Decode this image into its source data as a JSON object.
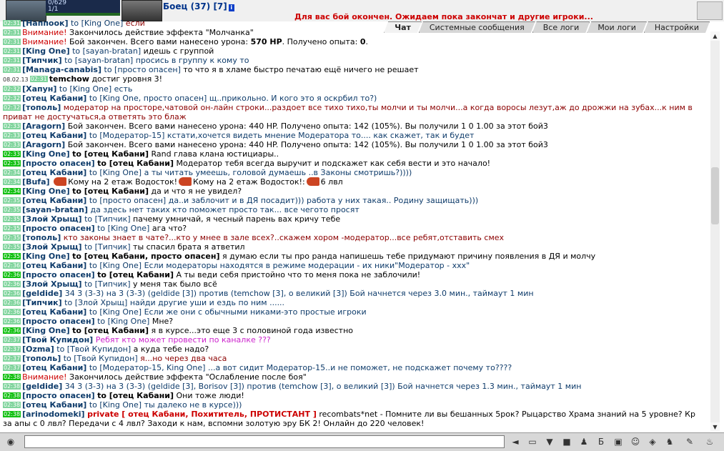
{
  "header": {
    "hp": "0/629",
    "mana": "1/1",
    "fighter": "Боец (37) [7]",
    "info_icon": "i",
    "fight_msg": "Для вас бой окончен. Ожидаем пока закончат и другие игроки..."
  },
  "tabs": [
    {
      "label": "Чат"
    },
    {
      "label": "Системные сообщения"
    },
    {
      "label": "Все логи"
    },
    {
      "label": "Мои логи"
    },
    {
      "label": "Настройки"
    }
  ],
  "messages": [
    {
      "time": "02:31",
      "hl": false,
      "nick": "Наппоок",
      "to": "to [King One]",
      "text": "если",
      "cls": "t-red"
    },
    {
      "time": "02:31",
      "hl": false,
      "warn": "Внимание!",
      "text": "Закончилось действие эффекта \"Молчанка\"",
      "cls": "t-black"
    },
    {
      "time": "02:31",
      "hl": false,
      "warn": "Внимание!",
      "text": "Бой закончен. Всего вами нанесено урона: 570 HP. Получено опыта: 0.",
      "cls": "t-black"
    },
    {
      "time": "02:31",
      "hl": false,
      "nick": "King One",
      "to": "to [sayan-bratan]",
      "text": "идешь с группой",
      "cls": "t-black"
    },
    {
      "time": "02:31",
      "hl": false,
      "nick": "Типчик",
      "to": "to [sayan-bratan]",
      "text": "просись в группу к кому то",
      "cls": "t-blue"
    },
    {
      "time": "02:31",
      "hl": false,
      "nick": "Managa-canabis",
      "to": "to [просто опасен]",
      "text": "то что я в хламе быстро печатаю ещё ничего не решает",
      "cls": "t-black"
    },
    {
      "date": "08.02.13",
      "time": "02:31",
      "hl": false,
      "nick": "temchow",
      "plain": true,
      "text": "достиг уровня 3!",
      "cls": "t-black"
    },
    {
      "time": "02:32",
      "hl": false,
      "nick": "Хапун",
      "to": "to [King One]",
      "text": "есть",
      "cls": "t-blue"
    },
    {
      "time": "02:32",
      "hl": false,
      "nick": "отец Кабани",
      "to": "to [King One, просто опасен]",
      "text": "щ..прикольно. И кого это я оскрбил то?)",
      "cls": "t-blue"
    },
    {
      "time": "02:32",
      "hl": false,
      "nick": "тополь",
      "to": "",
      "text": "модератор на просторе,чатовой он-лайн строки...раздоет все тихо тихо,ты молчи и ты молчи...а когда воросы лезут,аж до дрожжи на зубах...к ним в приват не достучаться,а ответять это блаж",
      "cls": "t-red",
      "wrap": true
    },
    {
      "time": "02:33",
      "hl": false,
      "nick": "Aragorn",
      "to": "",
      "text": "Бой закончен. Всего вами нанесено урона: 440 HP. Получено опыта: 142 (105%). Вы получили 1 0 1.00 за этот бой3",
      "cls": "t-black"
    },
    {
      "time": "02:33",
      "hl": false,
      "nick": "отец Кабани",
      "to": "to [Модератор-15]",
      "text": "кстати,хочется видеть мнение Модератора то.... как скажет, так и будет",
      "cls": "t-blue"
    },
    {
      "time": "02:33",
      "hl": false,
      "nick": "Aragorn",
      "to": "",
      "text": "Бой закончен. Всего вами нанесено урона: 440 HP. Получено опыта: 142 (105%). Вы получили 1 0 1.00 за этот бой3",
      "cls": "t-black"
    },
    {
      "time": "02:33",
      "hl": true,
      "nick": "King One",
      "bto": "to [отец Кабани]",
      "text": "Rand глава клана юстициары..",
      "cls": "t-black"
    },
    {
      "time": "02:33",
      "hl": true,
      "nick": "просто опасен",
      "bto": "to [отец Кабани]",
      "text": "Модератор тебя всегда выручит и подскажет как себя вести и это начало!",
      "cls": "t-black"
    },
    {
      "time": "02:34",
      "hl": false,
      "nick": "отец Кабани",
      "to": "to [King One]",
      "text": "а ты читать умеешь, головой думаешь ..в Законы смотришь?))))",
      "cls": "t-blue"
    },
    {
      "time": "02:34",
      "hl": false,
      "nick": "Bufa",
      "to": "",
      "text": "Кому на 2 етаж Водосток!",
      "text2": "Кому на 2 етаж Водосток!:",
      "text3": "6 лвл",
      "cls": "t-black",
      "smiles": true
    },
    {
      "time": "02:34",
      "hl": true,
      "nick": "King One",
      "bto": "to [отец Кабани]",
      "text": "да и что я не увидел?",
      "cls": "t-black"
    },
    {
      "time": "02:35",
      "hl": false,
      "nick": "отец Кабани",
      "to": "to [просто опасен]",
      "text": "да..и заблочит и в ДЯ посадит))) работа у них такая.. Родину защищать)))",
      "cls": "t-blue"
    },
    {
      "time": "02:35",
      "hl": false,
      "nick": "sayan-bratan",
      "to": "",
      "text": "да здесь нет таких кто поможет просто так... все чегото просят",
      "cls": "t-blue"
    },
    {
      "time": "02:35",
      "hl": false,
      "nick": "Злой Хрыщ",
      "to": "to [Типчик]",
      "text": "пачему умничай, я чесный парень вах кричу тебе",
      "cls": "t-black"
    },
    {
      "time": "02:35",
      "hl": false,
      "nick": "просто опасен",
      "to": "to [King One]",
      "text": "ага что?",
      "cls": "t-black"
    },
    {
      "time": "02:35",
      "hl": false,
      "nick": "тополь",
      "to": "",
      "text": "кто законы знает в чате?...кто у мнее в зале всех?..скажем хором -модератор...все ребят,отставить смех",
      "cls": "t-red"
    },
    {
      "time": "02:35",
      "hl": false,
      "nick": "Злой Хрыщ",
      "to": "to [Типчик]",
      "text": "ты спасил брата я атветил",
      "cls": "t-black"
    },
    {
      "time": "02:35",
      "hl": true,
      "nick": "King One",
      "bto": "to [отец Кабани, просто опасен]",
      "text": "я думаю если ты про ранда напишешь тебе придумают причину появления в ДЯ и молчу",
      "cls": "t-black"
    },
    {
      "time": "02:36",
      "hl": false,
      "nick": "отец Кабани",
      "to": "to [King One]",
      "text": "Если модераторы находятся в режиме модерации - их ники\"Модератор - ххх\"",
      "cls": "t-blue"
    },
    {
      "time": "02:36",
      "hl": true,
      "nick": "просто опасен",
      "bto": "to [отец Кабани]",
      "text": "А ты веди себя пристойно что то меня пока не заблочили!",
      "cls": "t-black"
    },
    {
      "time": "02:36",
      "hl": false,
      "nick": "Злой Хрыщ",
      "to": "to [Типчик]",
      "text": "у меня так было всё",
      "cls": "t-black"
    },
    {
      "time": "02:36",
      "hl": false,
      "nick": "geldide",
      "to": "",
      "text": "34 3 (3-3) на 3 (3-3) (geldide [3]) против (temchow [3], о великий [3]) Бой начнется через 3.0 мин., таймаут 1 мин",
      "cls": "t-blue"
    },
    {
      "time": "02:36",
      "hl": false,
      "nick": "Типчик",
      "to": "to [Злой Хрыщ]",
      "text": "найди другие уши и ездь по ним ......",
      "cls": "t-blue"
    },
    {
      "time": "02:36",
      "hl": false,
      "nick": "отец Кабани",
      "to": "to [King One]",
      "text": "Если же они с обычными никами-это простые игроки",
      "cls": "t-blue"
    },
    {
      "time": "02:36",
      "hl": false,
      "nick": "просто опасен",
      "to": "to [King One]",
      "text": "Мне?",
      "cls": "t-black"
    },
    {
      "time": "02:36",
      "hl": true,
      "nick": "King One",
      "bto": "to [отец Кабани]",
      "text": "я в курсе...это еще 3 с половиной года известно",
      "cls": "t-black"
    },
    {
      "time": "02:37",
      "hl": false,
      "nick": "Твой Купидон",
      "to": "",
      "text": "Ребят кто может провести по каналке ???",
      "cls": "t-pink"
    },
    {
      "time": "02:37",
      "hl": false,
      "nick": "Ozma",
      "to": "to [Твой Купидон]",
      "text": "а куда тебе надо?",
      "cls": "t-black"
    },
    {
      "time": "02:37",
      "hl": false,
      "nick": "тополь",
      "to": "to [Твой Купидон]",
      "text": "я...но через два часа",
      "cls": "t-red"
    },
    {
      "time": "02:37",
      "hl": false,
      "nick": "отец Кабани",
      "to": "to [Модератор-15, King One]",
      "text": "...а вот сидит Модератор-15..и не поможет, не подскажет почему то????",
      "cls": "t-blue"
    },
    {
      "time": "02:38",
      "hl": true,
      "warn": "Внимание!",
      "text": "Закончилось действие эффекта \"Ослабление после боя\"",
      "cls": "t-black"
    },
    {
      "time": "02:38",
      "hl": false,
      "nick": "geldide",
      "to": "",
      "text": "34 3 (3-3) на 3 (3-3) (geldide [3], Borisov [3]) против (temchow [3], о великий [3]) Бой начнется через 1.3 мин., таймаут 1 мин",
      "cls": "t-blue"
    },
    {
      "time": "02:38",
      "hl": true,
      "nick": "просто опасен",
      "bto": "to [отец Кабани]",
      "text": "Они тоже люди!",
      "cls": "t-black"
    },
    {
      "time": "02:38",
      "hl": false,
      "nick": "отец Кабани",
      "to": "to [King One]",
      "text": "ты далеко не в курсе)))",
      "cls": "t-blue"
    },
    {
      "time": "02:38",
      "hl": true,
      "nick": "arinodomeki",
      "priv": "private [ отец Кабани, Похититель, ПРОТИСТАНТ ]",
      "text": "recombats*net - Помните ли вы бешанных 5рок? Рыцарство Храма знаний на 5 уровне? Кр за апы с 0 лвл? Передачи с 4 лвл? Заходи к нам, вспомни золотую эру БК 2! Онлайн до 220 человек!",
      "cls": "t-black",
      "wrap": true
    }
  ],
  "input": {
    "value": ""
  }
}
